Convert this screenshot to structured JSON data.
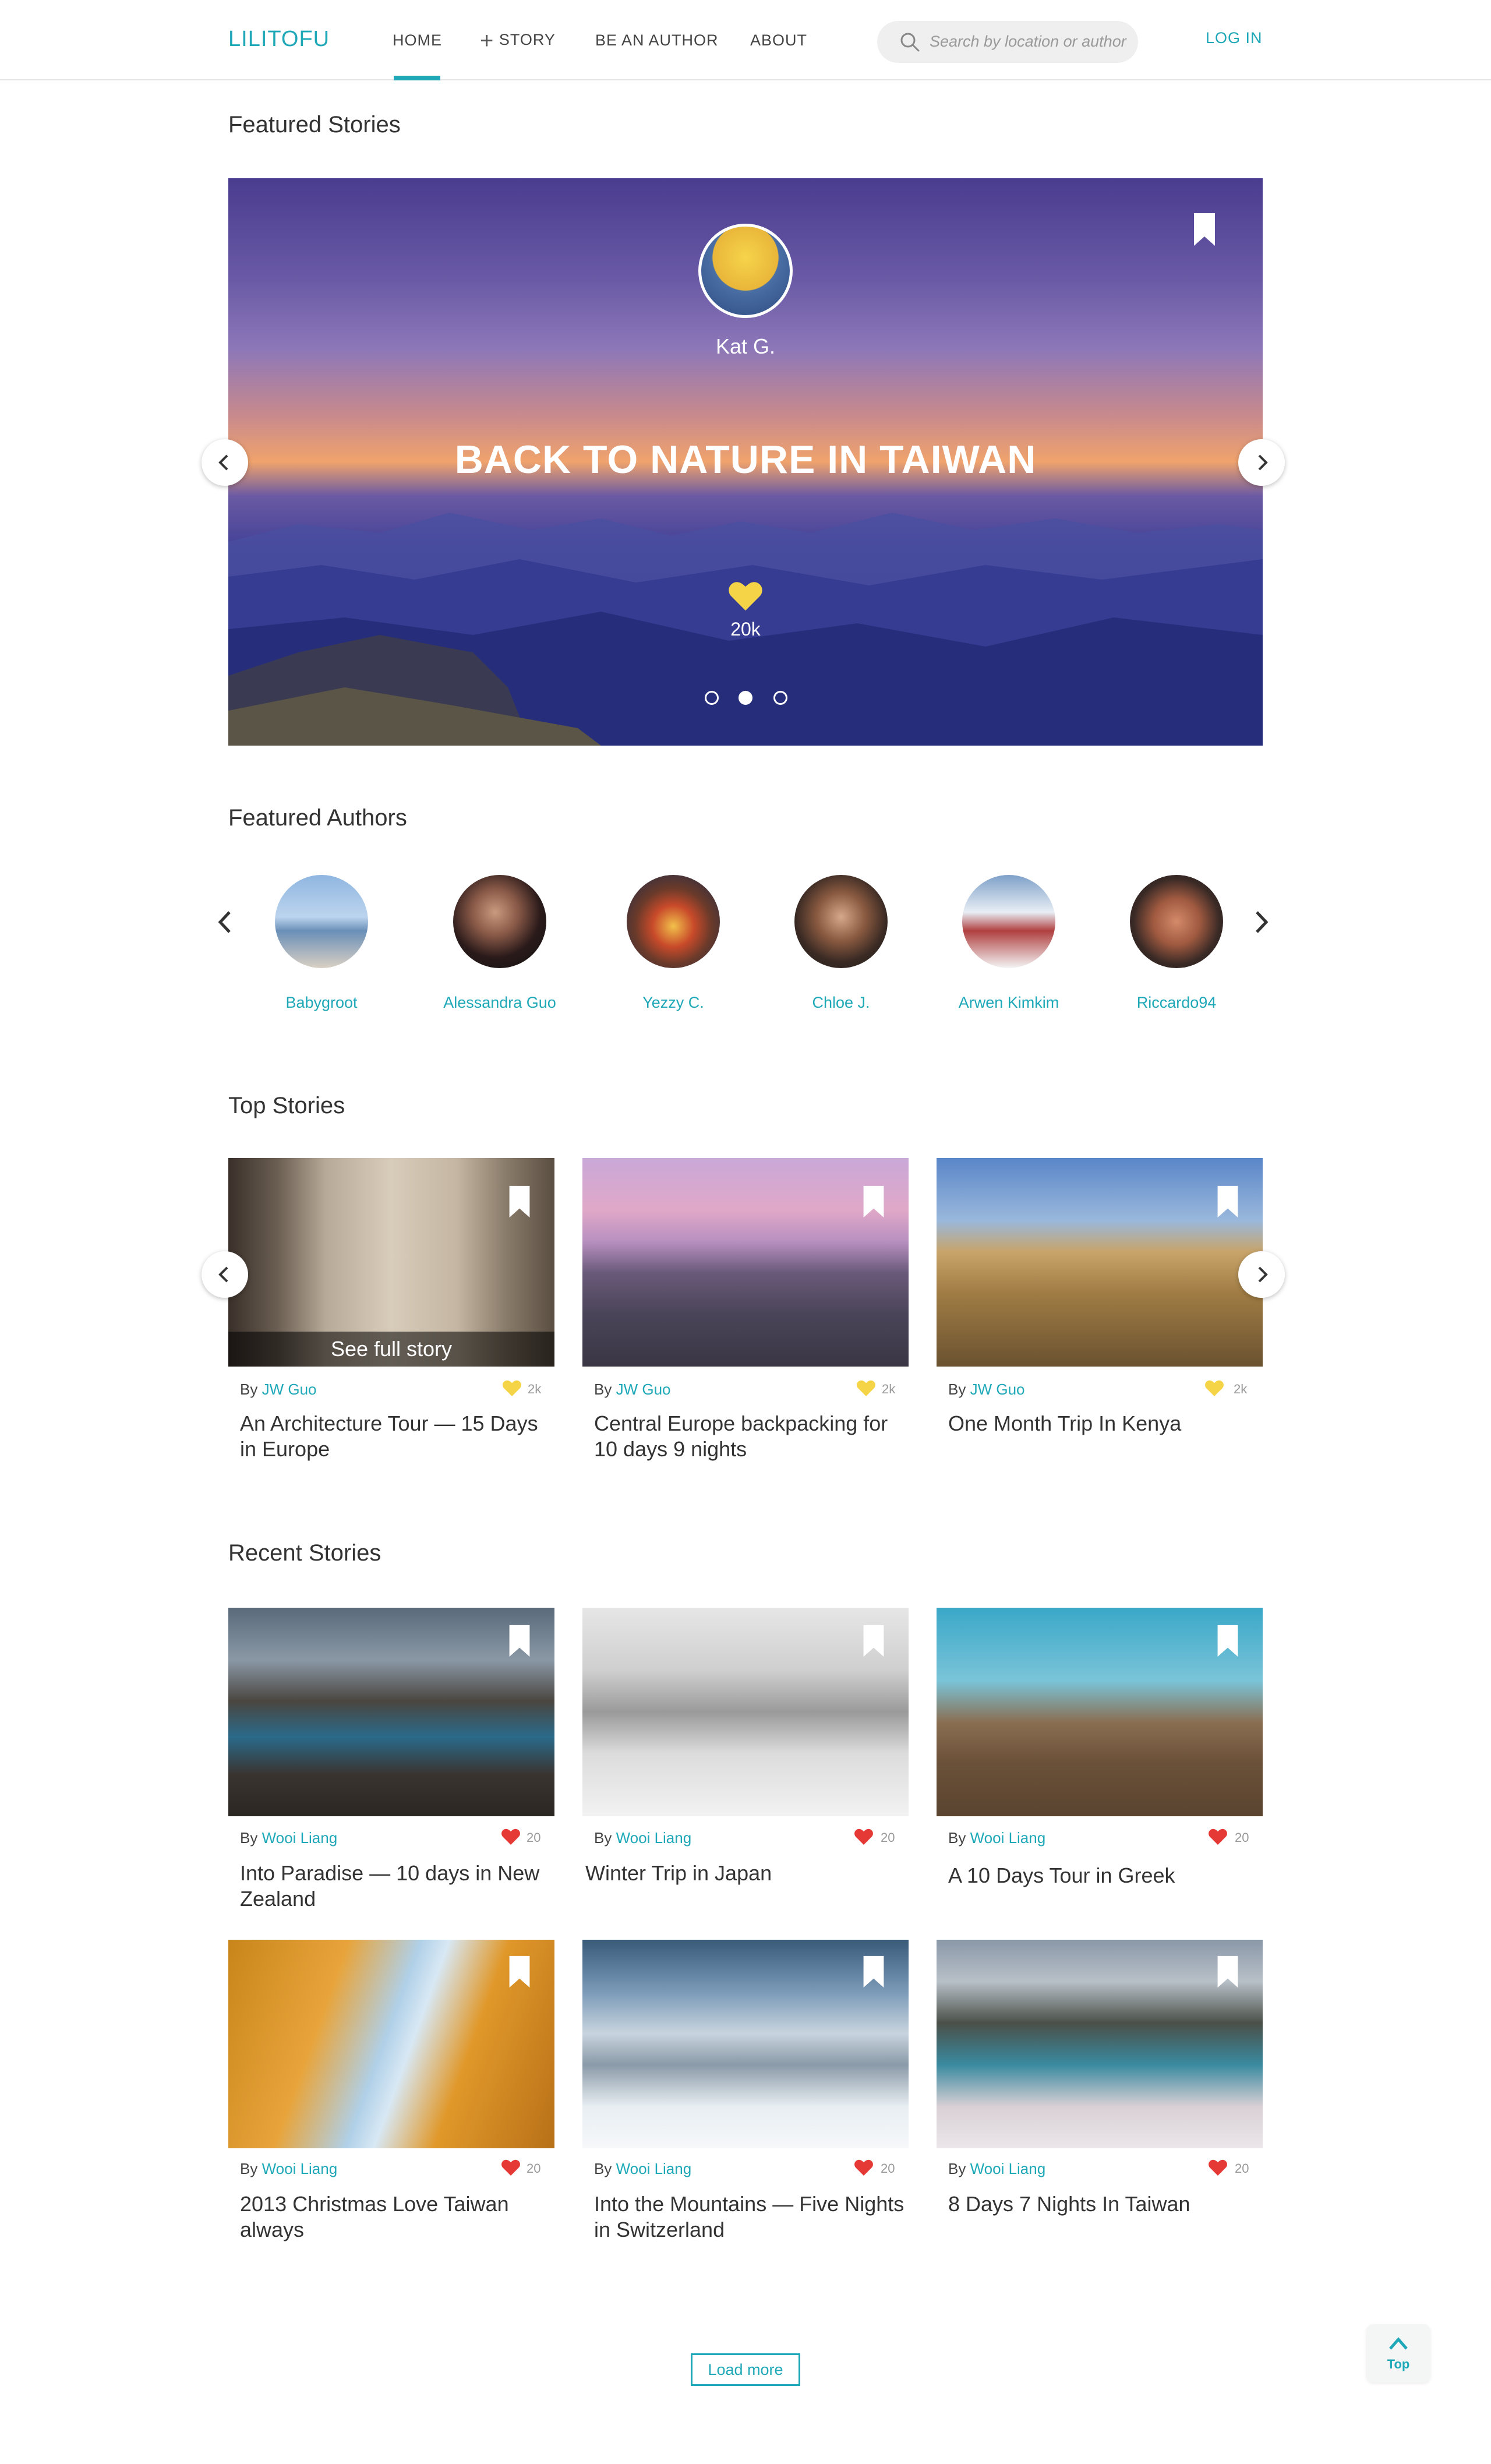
{
  "header": {
    "logo": "LILITOFU",
    "nav": {
      "home": "HOME",
      "story": "STORY",
      "author": "BE AN AUTHOR",
      "about": "ABOUT"
    },
    "search_placeholder": "Search by location or author",
    "login": "LOG IN"
  },
  "featured": {
    "title": "Featured Stories",
    "author": "Kat G.",
    "story_title": "BACK TO NATURE IN TAIWAN",
    "likes": "20k",
    "active_dot": 2
  },
  "authors": {
    "title": "Featured Authors",
    "items": [
      {
        "name": "Babygroot"
      },
      {
        "name": "Alessandra Guo"
      },
      {
        "name": "Yezzy C."
      },
      {
        "name": "Chloe J."
      },
      {
        "name": "Arwen Kimkim"
      },
      {
        "name": "Riccardo94"
      }
    ]
  },
  "top_stories": {
    "title": "Top Stories",
    "overlay": "See full story",
    "by": "By",
    "items": [
      {
        "author": "JW Guo",
        "likes": "2k",
        "title": "An Architecture Tour — 15 Days in Europe"
      },
      {
        "author": "JW Guo",
        "likes": "2k",
        "title": "Central Europe backpacking for 10 days 9 nights"
      },
      {
        "author": "JW Guo",
        "likes": "2k",
        "title": "One Month Trip In Kenya"
      }
    ]
  },
  "recent_stories": {
    "title": "Recent Stories",
    "by": "By",
    "items": [
      {
        "author": "Wooi Liang",
        "likes": "20",
        "title": "Into Paradise — 10 days in New Zealand"
      },
      {
        "author": "Wooi Liang",
        "likes": "20",
        "title": "Winter Trip in Japan"
      },
      {
        "author": "Wooi Liang",
        "likes": "20",
        "title": "A 10 Days Tour in Greek"
      },
      {
        "author": "Wooi Liang",
        "likes": "20",
        "title": "2013 Christmas Love Taiwan always"
      },
      {
        "author": "Wooi Liang",
        "likes": "20",
        "title": "Into the Mountains — Five Nights in Switzerland"
      },
      {
        "author": "Wooi Liang",
        "likes": "20",
        "title": "8 Days 7 Nights In Taiwan"
      }
    ]
  },
  "load_more": "Load more",
  "top_button": "Top",
  "colors": {
    "accent": "#1fa8b8",
    "gold_heart": "#f5d547",
    "red_heart": "#e53935"
  }
}
